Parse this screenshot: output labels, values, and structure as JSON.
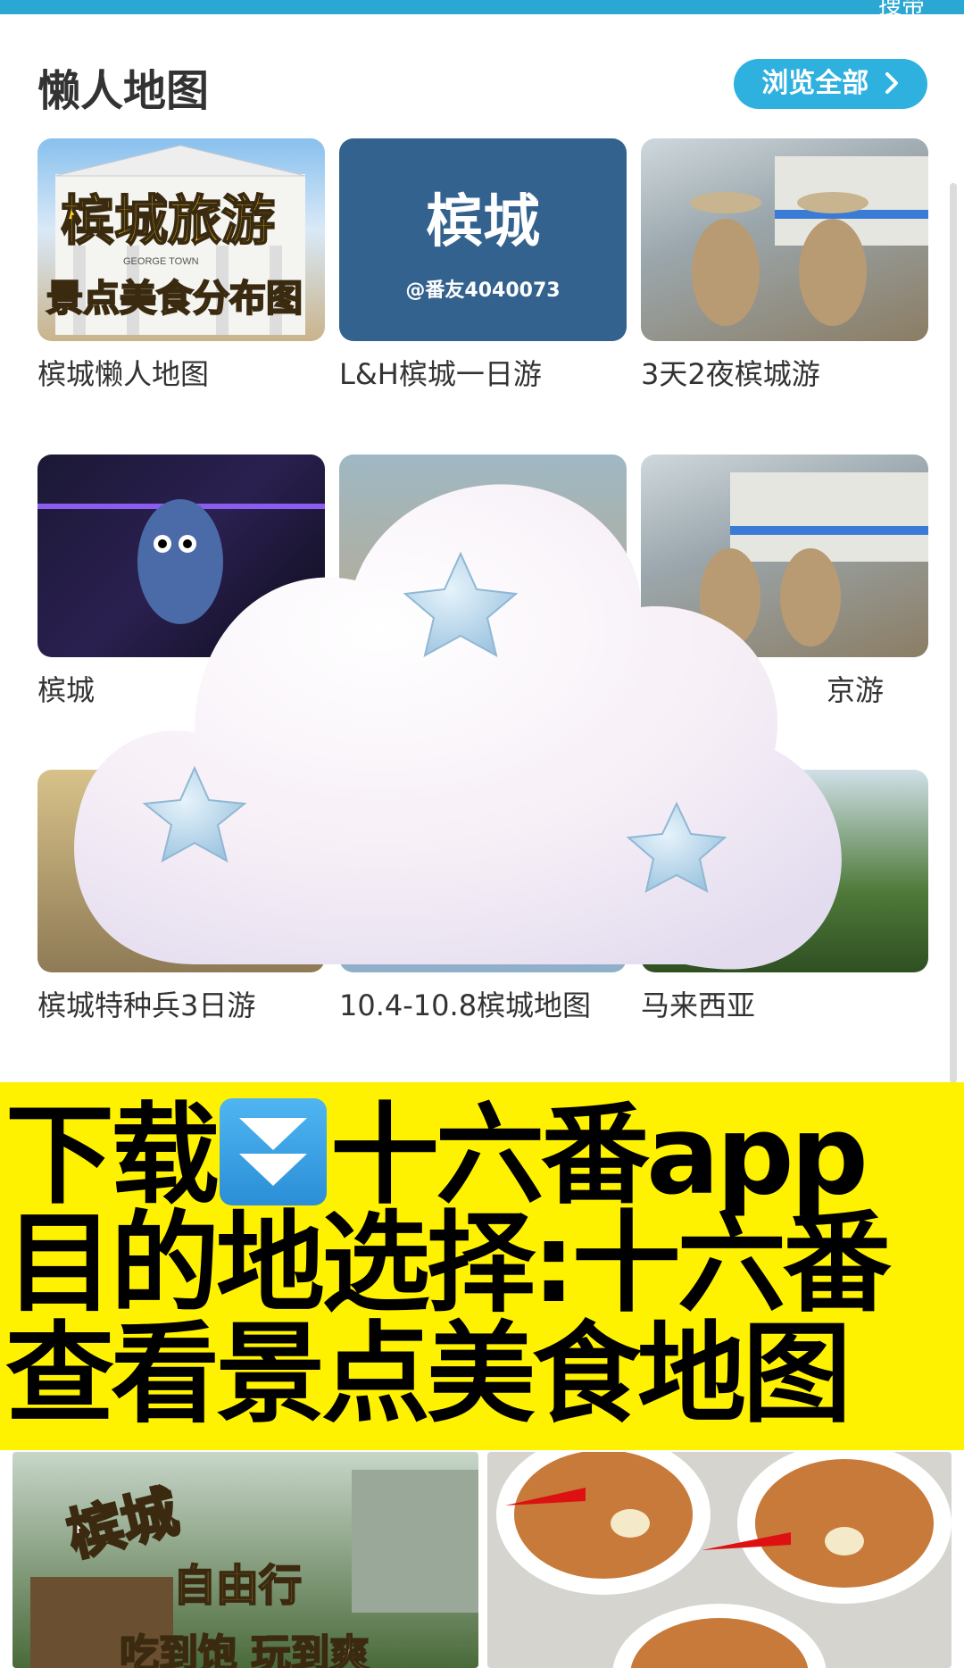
{
  "status_bar": {
    "label": "搜带"
  },
  "section": {
    "title": "懒人地图",
    "browse_all": "浏览全部"
  },
  "cards": [
    {
      "caption": "槟城懒人地图",
      "thumb_title": "槟城旅游",
      "thumb_sub": "景点美食分布图",
      "thumb_sign": "GEORGE TOWN"
    },
    {
      "caption": "L&H槟城一日游",
      "thumb_title": "槟城",
      "thumb_sub": "@番友4040073"
    },
    {
      "caption": "3天2夜槟城游"
    },
    {
      "caption": "槟城"
    },
    {
      "caption": ""
    },
    {
      "caption": "京游"
    },
    {
      "caption": "槟城特种兵3日游"
    },
    {
      "caption": "10.4-10.8槟城地图"
    },
    {
      "caption": "马来西亚"
    }
  ],
  "banner": {
    "line1a": "下载",
    "line1b": "十六番app",
    "line2": "目的地选择:十六番",
    "line3": "查看景点美食地图",
    "icon": "double-down-arrow-icon"
  },
  "bottom": {
    "left_title": "槟城",
    "left_sub": "自由行",
    "left_tag": "吃到饱 玩到爽"
  },
  "colors": {
    "accent": "#2fb1df",
    "banner_yellow": "#fff200",
    "thumb_navy": "#33628e"
  }
}
